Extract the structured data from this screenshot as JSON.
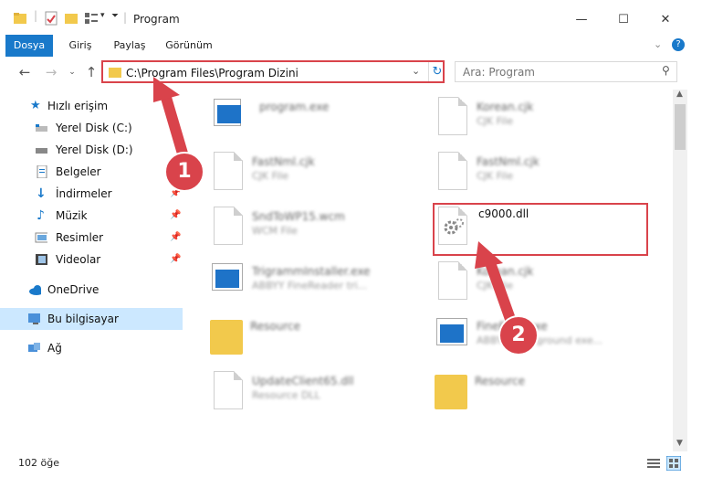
{
  "window": {
    "title": "Program"
  },
  "ribbon": {
    "tabs": [
      "Dosya",
      "Giriş",
      "Paylaş",
      "Görünüm"
    ]
  },
  "address": {
    "path": "C:\\Program Files\\Program Dizini"
  },
  "search": {
    "placeholder": "Ara: Program"
  },
  "sidebar": {
    "items": [
      {
        "label": "Hızlı erişim"
      },
      {
        "label": "Yerel Disk (C:)"
      },
      {
        "label": "Yerel Disk (D:)"
      },
      {
        "label": "Belgeler"
      },
      {
        "label": "İndirmeler"
      },
      {
        "label": "Müzik"
      },
      {
        "label": "Resimler"
      },
      {
        "label": "Videolar"
      },
      {
        "label": "OneDrive"
      },
      {
        "label": "Bu bilgisayar"
      },
      {
        "label": "Ağ"
      }
    ]
  },
  "files": [
    {
      "name": "program.exe",
      "type": ""
    },
    {
      "name": "Korean.cjk",
      "type": "CJK File"
    },
    {
      "name": "FastNml.cjk",
      "type": "CJK File"
    },
    {
      "name": "FastNml.cjk",
      "type": "CJK File"
    },
    {
      "name": "SndToWP15.wcm",
      "type": "WCM File"
    },
    {
      "name": "c9000.dll",
      "type": ""
    },
    {
      "name": "TrigrammInstaller.exe",
      "type": "ABBYY FineReader tri..."
    },
    {
      "name": "Korean.cjk",
      "type": "CJK File"
    },
    {
      "name": "Resource",
      "type": ""
    },
    {
      "name": "FineExec.exe",
      "type": "ABBYY Background exe..."
    },
    {
      "name": "UpdateClient65.dll",
      "type": "Resource DLL"
    },
    {
      "name": "Resource",
      "type": ""
    }
  ],
  "status": {
    "item_count": "102 öğe"
  },
  "annotations": {
    "step1": "1",
    "step2": "2"
  },
  "colors": {
    "accent": "#1979ca",
    "highlight": "#d9434b",
    "selection": "#cce8ff"
  }
}
